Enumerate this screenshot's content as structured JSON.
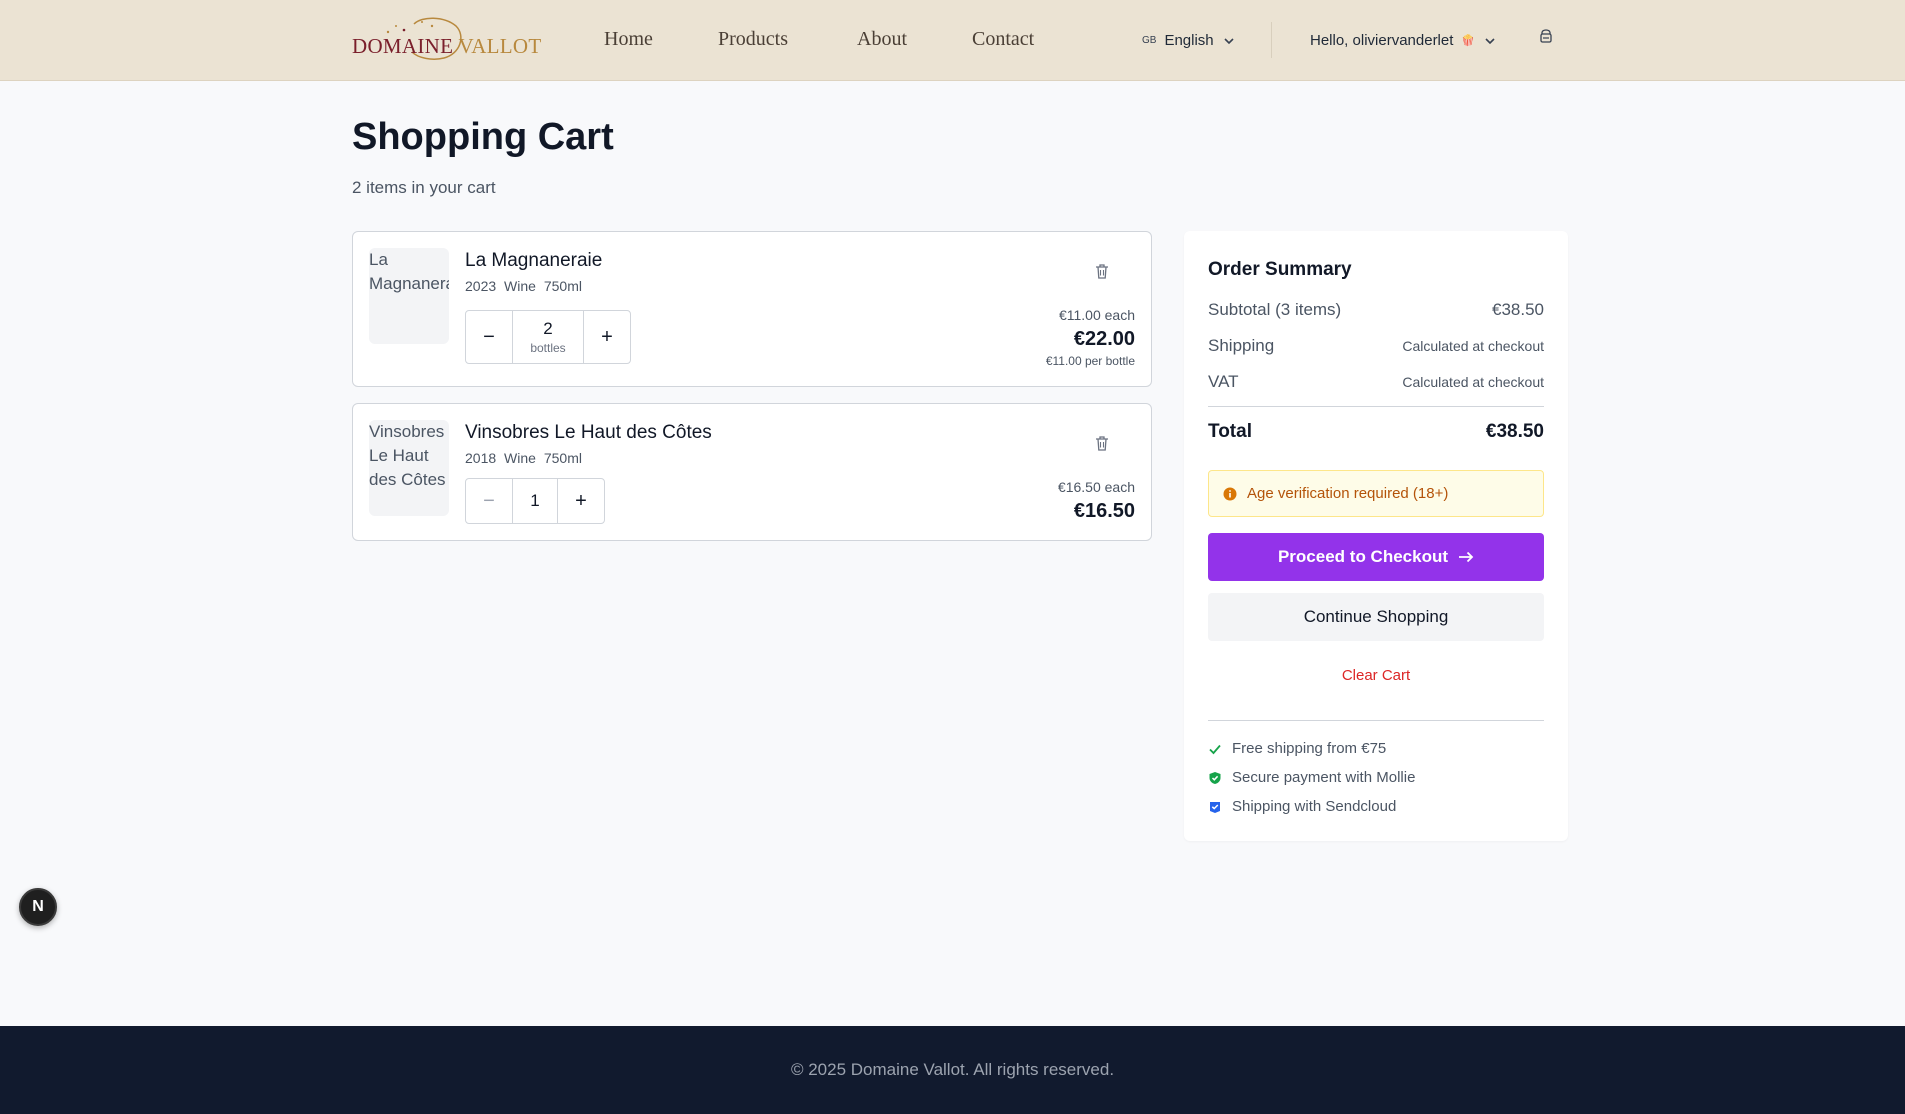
{
  "brand": {
    "logo_part1": "DOMAINE",
    "logo_part2": "VALLOT",
    "color_primary": "#7a1f2b",
    "color_gold": "#b8893e"
  },
  "nav": {
    "items": [
      {
        "label": "Home"
      },
      {
        "label": "Products"
      },
      {
        "label": "About"
      },
      {
        "label": "Contact"
      }
    ]
  },
  "language": {
    "flag": "GB",
    "label": "English",
    "icon": "chevron-down-icon"
  },
  "user": {
    "greeting": "Hello, oliviervanderlet",
    "emoji": "🍿",
    "icon": "chevron-down-icon"
  },
  "page": {
    "title": "Shopping Cart",
    "subtitle": "2 items in your cart"
  },
  "cart": {
    "items": [
      {
        "image_alt": "La Magnaneraie",
        "name": "La Magnaneraie",
        "year": "2023",
        "type": "Wine",
        "volume": "750ml",
        "quantity": "2",
        "quantity_unit": "bottles",
        "price_each": "€11.00 each",
        "line_total": "€22.00",
        "price_per_bottle": "€11.00 per bottle"
      },
      {
        "image_alt": "Vinsobres Le Haut des Côtes",
        "name": "Vinsobres Le Haut des Côtes",
        "year": "2018",
        "type": "Wine",
        "volume": "750ml",
        "quantity": "1",
        "price_each": "€16.50 each",
        "line_total": "€16.50"
      }
    ],
    "minus_label": "−",
    "plus_label": "+"
  },
  "summary": {
    "title": "Order Summary",
    "subtotal_label": "Subtotal (3 items)",
    "subtotal_value": "€38.50",
    "shipping_label": "Shipping",
    "shipping_value": "Calculated at checkout",
    "vat_label": "VAT",
    "vat_value": "Calculated at checkout",
    "total_label": "Total",
    "total_value": "€38.50",
    "age_notice": "Age verification required (18+)",
    "checkout_label": "Proceed to Checkout",
    "continue_label": "Continue Shopping",
    "clear_label": "Clear Cart",
    "features": [
      {
        "label": "Free shipping from €75",
        "icon": "check-icon"
      },
      {
        "label": "Secure payment with Mollie",
        "icon": "shield-check-icon"
      },
      {
        "label": "Shipping with Sendcloud",
        "icon": "sendcloud-icon"
      }
    ],
    "accent_color": "#9333ea"
  },
  "dev_badge": {
    "label": "N"
  },
  "footer": {
    "copyright": "© 2025 Domaine Vallot. All rights reserved."
  }
}
